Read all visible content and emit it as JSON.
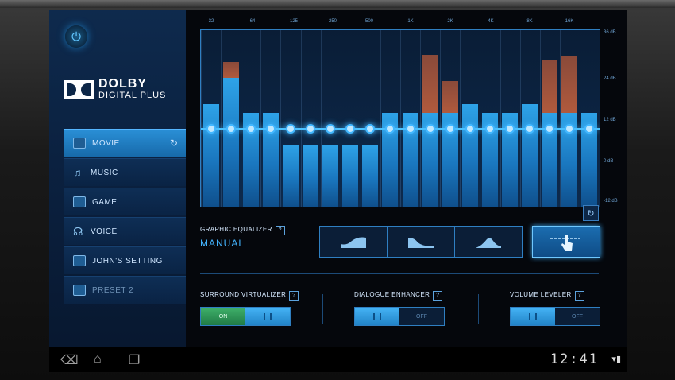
{
  "sidebar": {
    "brand": {
      "line1": "DOLBY",
      "line2": "DIGITAL PLUS"
    },
    "items": [
      {
        "label": "MOVIE",
        "icon": "film-icon",
        "active": true
      },
      {
        "label": "MUSIC",
        "icon": "music-note-icon"
      },
      {
        "label": "GAME",
        "icon": "gamepad-icon"
      },
      {
        "label": "VOICE",
        "icon": "voice-icon"
      },
      {
        "label": "JOHN'S SETTING",
        "icon": "preset-1-icon"
      },
      {
        "label": "PRESET 2",
        "icon": "preset-2-icon",
        "dim": true
      }
    ]
  },
  "equalizer": {
    "freq_labels": [
      "32",
      "64",
      "125",
      "250",
      "500",
      "1K",
      "2K",
      "4K",
      "8K",
      "16K"
    ],
    "db_labels": [
      "36 dB",
      "24 dB",
      "12 dB",
      "0 dB",
      "-12 dB"
    ],
    "title": "GRAPHIC EQUALIZER",
    "mode": "MANUAL",
    "help": "?",
    "levels": [
      0.58,
      0.73,
      0.53,
      0.53,
      0.35,
      0.35,
      0.35,
      0.35,
      0.35,
      0.53,
      0.53,
      0.53,
      0.53,
      0.58,
      0.53,
      0.53,
      0.58,
      0.53,
      0.53,
      0.53
    ],
    "peaks": [
      0,
      0.82,
      0,
      0,
      0,
      0,
      0,
      0,
      0,
      0,
      0,
      0.86,
      0.71,
      0,
      0,
      0,
      0,
      0.83,
      0.85,
      0
    ],
    "node_level": 0.44
  },
  "controls": {
    "surround": {
      "title": "SURROUND VIRTUALIZER",
      "state": "ON"
    },
    "dialogue": {
      "title": "DIALOGUE ENHANCER",
      "state": "OFF"
    },
    "volume": {
      "title": "VOLUME LEVELER",
      "state": "OFF"
    },
    "help": "?"
  },
  "navbar": {
    "time": "12:41"
  },
  "colors": {
    "accent": "#2ea3e8",
    "on_green": "#3fb06a",
    "peak": "#b05a3d"
  }
}
